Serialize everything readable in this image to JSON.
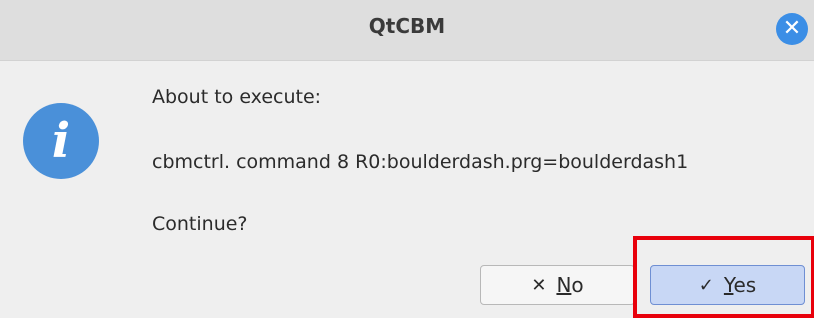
{
  "window": {
    "title": "QtCBM",
    "close_glyph": "✕"
  },
  "dialog": {
    "icon": "info-icon",
    "icon_glyph": "i",
    "line1": "About to execute:",
    "line2": "cbmctrl. command 8 R0:boulderdash.prg=boulderdash1",
    "line3": "Continue?"
  },
  "buttons": {
    "no": {
      "icon_glyph": "✕",
      "mnemonic": "N",
      "rest": "o"
    },
    "yes": {
      "icon_glyph": "✓",
      "mnemonic": "Y",
      "rest": "es"
    }
  },
  "colors": {
    "accent": "#3b8ee6",
    "info_icon": "#4a90d9",
    "yes_button": "#c8d7f5",
    "highlight": "#e8000b"
  }
}
